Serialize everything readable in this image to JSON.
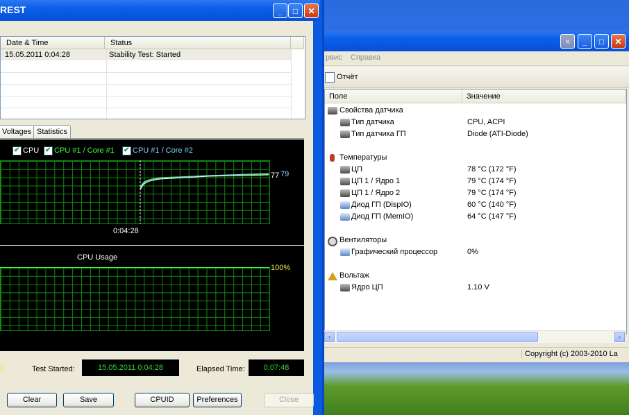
{
  "right_window": {
    "menu": [
      "рвис",
      "Справка"
    ],
    "toolbar": {
      "report_label": "Отчёт"
    },
    "columns": {
      "field": "Поле",
      "value": "Значение"
    },
    "rows": [
      {
        "label": "Свойства датчика",
        "value": "",
        "icon": "sensor-chip-icon"
      },
      {
        "label": "Тип датчика",
        "value": "CPU, ACPI",
        "icon": "chip-icon"
      },
      {
        "label": "Тип датчика ГП",
        "value": "Diode  (ATI-Diode)",
        "icon": "chip-icon"
      },
      {
        "label": "Температуры",
        "value": "",
        "icon": "thermometer-icon"
      },
      {
        "label": "ЦП",
        "value": "78 °C  (172 °F)",
        "icon": "cpu-icon"
      },
      {
        "label": "ЦП 1 / Ядро 1",
        "value": "79 °C  (174 °F)",
        "icon": "cpu-icon"
      },
      {
        "label": "ЦП 1 / Ядро 2",
        "value": "79 °C  (174 °F)",
        "icon": "cpu-icon"
      },
      {
        "label": "Диод ГП (DispIO)",
        "value": "60 °C  (140 °F)",
        "icon": "gpu-icon"
      },
      {
        "label": "Диод ГП (MemIO)",
        "value": "64 °C  (147 °F)",
        "icon": "gpu-icon"
      },
      {
        "label": "Вентиляторы",
        "value": "",
        "icon": "fan-icon"
      },
      {
        "label": "Графический процессор",
        "value": "0%",
        "icon": "gpu-icon"
      },
      {
        "label": "Вольтаж",
        "value": "",
        "icon": "voltage-icon"
      },
      {
        "label": "Ядро ЦП",
        "value": "1.10 V",
        "icon": "cpu-icon"
      }
    ],
    "status": "Copyright (c) 2003-2010 La"
  },
  "left_window": {
    "title": "REST",
    "event_table": {
      "headers": [
        "Date & Time",
        "Status"
      ],
      "rows": [
        {
          "datetime": "15.05.2011 0:04:28",
          "status": "Stability Test: Started"
        }
      ]
    },
    "tabs": [
      "Voltages",
      "Statistics"
    ],
    "temp_graph": {
      "legend": [
        "CPU",
        "CPU #1 / Core #1",
        "CPU #1 / Core #2"
      ],
      "legend_colors": [
        "#ffffff",
        "#3fff3f",
        "#7fd6ff"
      ],
      "end_values": [
        "77",
        "79"
      ],
      "time_marker": "0:04:28"
    },
    "usage_graph": {
      "title": "CPU Usage",
      "value": "100%"
    },
    "info": {
      "status_fragment": "y",
      "test_started_label": "Test Started:",
      "test_started_value": "15.05.2011 0:04:28",
      "elapsed_label": "Elapsed Time:",
      "elapsed_value": "0:07:48"
    },
    "buttons": {
      "clear": "Clear",
      "save": "Save",
      "cpuid": "CPUID",
      "preferences": "Preferences",
      "close": "Close"
    }
  }
}
